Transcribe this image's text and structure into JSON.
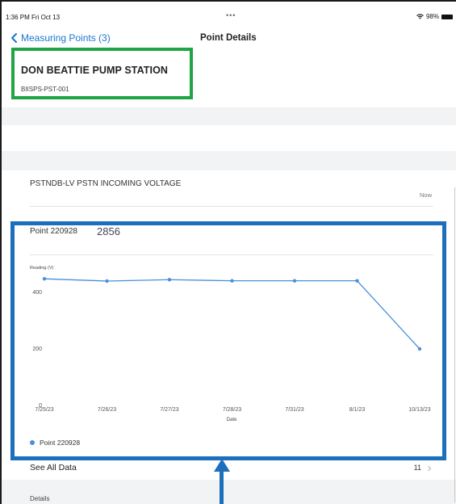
{
  "status_bar": {
    "time": "1:36 PM  Fri Oct 13",
    "dots": "•••",
    "battery": "98%"
  },
  "nav": {
    "back_label": "Measuring Points (3)",
    "title": "Point Details"
  },
  "header": {
    "station_name": "DON BEATTIE PUMP STATION",
    "station_id": "BIISPS-PST-001"
  },
  "reading": {
    "title": "PSTNDB-LV PSTN INCOMING VOLTAGE",
    "timestamp": "Now"
  },
  "point": {
    "label": "Point 220928",
    "value": "2856"
  },
  "chart_data": {
    "type": "line",
    "ylabel": "Reading (V)",
    "xlabel": "Date",
    "categories": [
      "7/25/23",
      "7/26/23",
      "7/27/23",
      "7/28/23",
      "7/31/23",
      "8/1/23",
      "10/13/23"
    ],
    "series": [
      {
        "name": "Point 220928",
        "values": [
          448,
          440,
          445,
          441,
          441,
          441,
          200
        ]
      }
    ],
    "yticks": [
      0,
      200,
      400
    ],
    "ylim": [
      0,
      500
    ],
    "color": "#4a8fd8"
  },
  "see_all": {
    "label": "See All Data",
    "count": "11"
  },
  "details": {
    "label": "Details"
  },
  "colors": {
    "accent": "#1976d2",
    "highlight_green": "#1fa446",
    "highlight_blue": "#1c6fbd"
  }
}
